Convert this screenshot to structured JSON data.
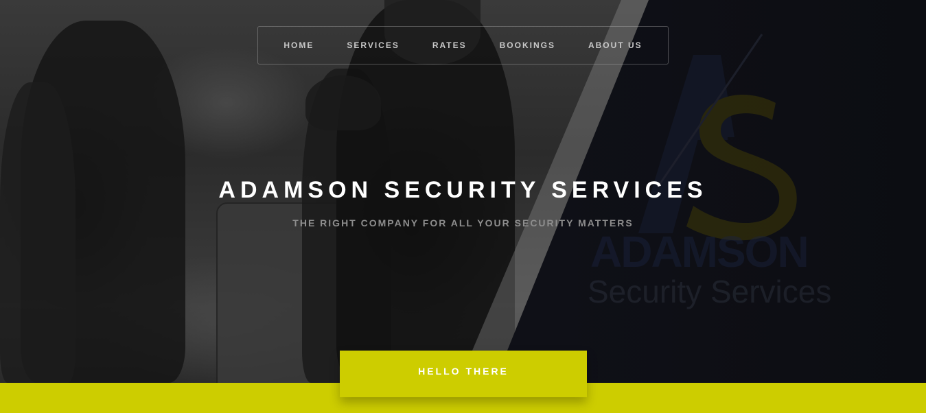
{
  "nav": {
    "items": [
      {
        "label": "HOME"
      },
      {
        "label": "SERVICES"
      },
      {
        "label": "RATES"
      },
      {
        "label": "BOOKINGS"
      },
      {
        "label": "ABOUT US"
      }
    ]
  },
  "hero": {
    "title": "ADAMSON SECURITY SERVICES",
    "subtitle": "THE RIGHT COMPANY FOR ALL YOUR SECURITY MATTERS",
    "cta_label": "HELLO THERE"
  },
  "logo": {
    "wordmark": "ADAMSON",
    "tagline": "Security Services",
    "initials": "AS"
  },
  "colors": {
    "accent": "#cdcd00",
    "dark_bg": "#0f1017",
    "text_white": "#ffffff",
    "text_muted": "#8e8e8e"
  }
}
